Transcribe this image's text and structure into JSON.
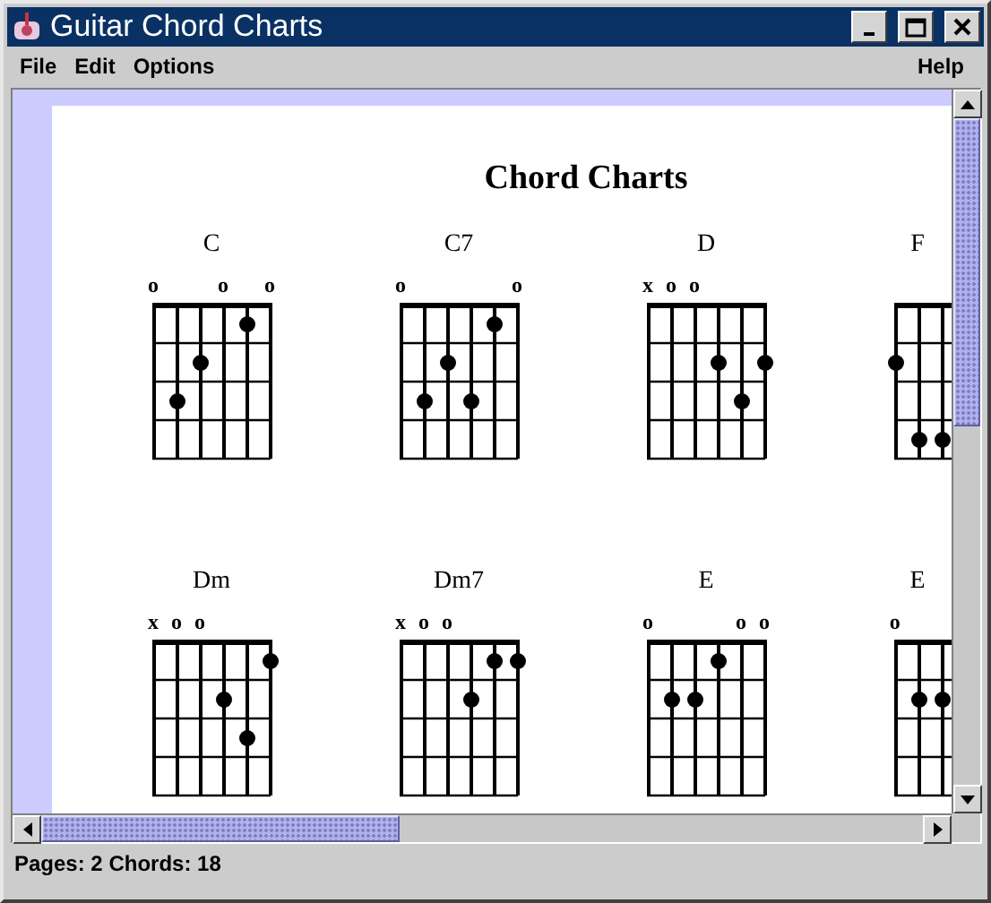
{
  "window": {
    "title": "Guitar Chord Charts"
  },
  "menu_left": [
    "File",
    "Edit",
    "Options"
  ],
  "menu_right": [
    "Help"
  ],
  "page": {
    "title": "Chord Charts"
  },
  "charts": [
    {
      "name": "C",
      "strings": [
        {
          "marker": "o",
          "frets": [
            false,
            false,
            false,
            false
          ]
        },
        {
          "frets": [
            false,
            false,
            true,
            false
          ]
        },
        {
          "frets": [
            false,
            true,
            false,
            false
          ]
        },
        {
          "marker": "o",
          "frets": [
            false,
            false,
            false,
            false
          ]
        },
        {
          "frets": [
            true,
            false,
            false,
            false
          ]
        },
        {
          "marker": "o",
          "frets": [
            false,
            false,
            false,
            false
          ]
        }
      ]
    },
    {
      "name": "C7",
      "strings": [
        {
          "marker": "o",
          "frets": [
            false,
            false,
            false,
            false
          ]
        },
        {
          "frets": [
            false,
            false,
            true,
            false
          ]
        },
        {
          "frets": [
            false,
            true,
            false,
            false
          ]
        },
        {
          "frets": [
            false,
            false,
            true,
            false
          ]
        },
        {
          "frets": [
            true,
            false,
            false,
            false
          ]
        },
        {
          "marker": "o",
          "frets": [
            false,
            false,
            false,
            false
          ]
        }
      ]
    },
    {
      "name": "D",
      "strings": [
        {
          "marker": "x",
          "frets": [
            false,
            false,
            false,
            false
          ]
        },
        {
          "marker": "o",
          "frets": [
            false,
            false,
            false,
            false
          ]
        },
        {
          "marker": "o",
          "frets": [
            false,
            false,
            false,
            false
          ]
        },
        {
          "frets": [
            false,
            true,
            false,
            false
          ]
        },
        {
          "frets": [
            false,
            false,
            true,
            false
          ]
        },
        {
          "frets": [
            false,
            true,
            false,
            false
          ]
        }
      ]
    },
    {
      "name": "F",
      "strings": [
        {
          "frets": [
            false,
            true,
            false,
            false
          ]
        },
        {
          "frets": [
            false,
            false,
            false,
            true
          ]
        },
        {
          "frets": [
            false,
            false,
            false,
            true
          ]
        }
      ]
    },
    {
      "name": "Dm",
      "strings": [
        {
          "marker": "x",
          "frets": [
            false,
            false,
            false,
            false
          ]
        },
        {
          "marker": "o",
          "frets": [
            false,
            false,
            false,
            false
          ]
        },
        {
          "marker": "o",
          "frets": [
            false,
            false,
            false,
            false
          ]
        },
        {
          "frets": [
            false,
            true,
            false,
            false
          ]
        },
        {
          "frets": [
            false,
            false,
            true,
            false
          ]
        },
        {
          "frets": [
            true,
            false,
            false,
            false
          ]
        }
      ]
    },
    {
      "name": "Dm7",
      "strings": [
        {
          "marker": "x",
          "frets": [
            false,
            false,
            false,
            false
          ]
        },
        {
          "marker": "o",
          "frets": [
            false,
            false,
            false,
            false
          ]
        },
        {
          "marker": "o",
          "frets": [
            false,
            false,
            false,
            false
          ]
        },
        {
          "frets": [
            false,
            true,
            false,
            false
          ]
        },
        {
          "frets": [
            true,
            false,
            false,
            false
          ]
        },
        {
          "frets": [
            true,
            false,
            false,
            false
          ]
        }
      ]
    },
    {
      "name": "E",
      "strings": [
        {
          "marker": "o",
          "frets": [
            false,
            false,
            false,
            false
          ]
        },
        {
          "frets": [
            false,
            true,
            false,
            false
          ]
        },
        {
          "frets": [
            false,
            true,
            false,
            false
          ]
        },
        {
          "frets": [
            true,
            false,
            false,
            false
          ]
        },
        {
          "marker": "o",
          "frets": [
            false,
            false,
            false,
            false
          ]
        },
        {
          "marker": "o",
          "frets": [
            false,
            false,
            false,
            false
          ]
        }
      ]
    },
    {
      "name": "E",
      "strings": [
        {
          "marker": "o",
          "frets": [
            false,
            false,
            false,
            false
          ]
        },
        {
          "frets": [
            false,
            true,
            false,
            false
          ]
        },
        {
          "frets": [
            false,
            true,
            false,
            false
          ]
        }
      ]
    }
  ],
  "status_bar": "Pages: 2 Chords: 18"
}
